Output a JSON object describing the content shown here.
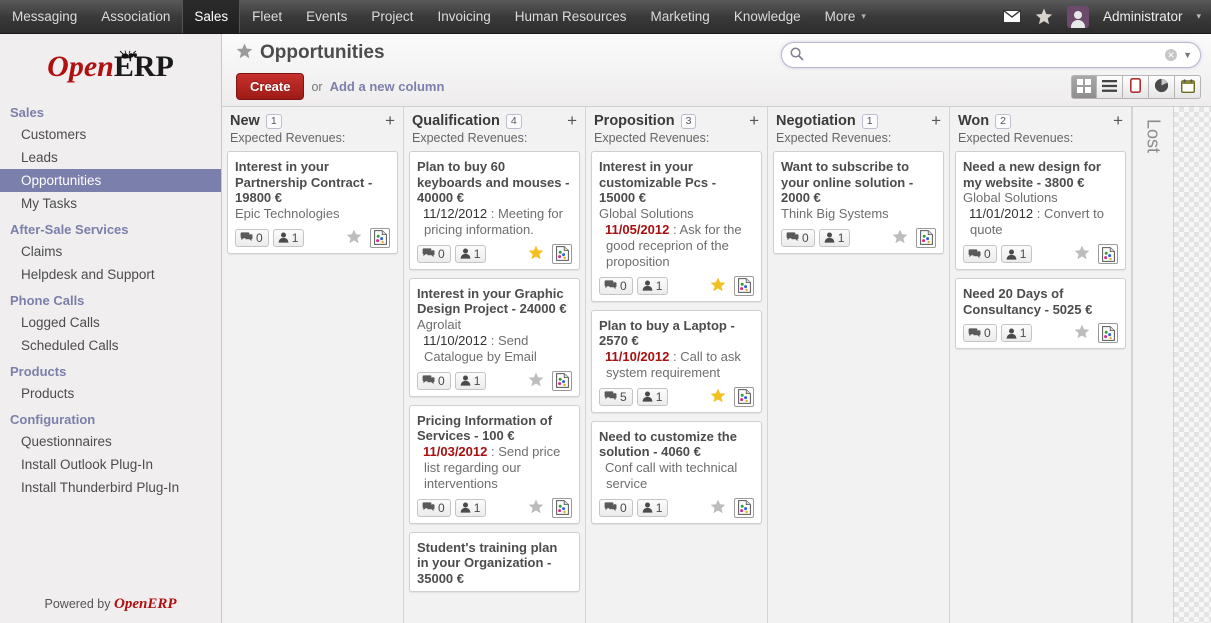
{
  "topbar": {
    "menus": [
      {
        "label": "Messaging",
        "active": false
      },
      {
        "label": "Association",
        "active": false
      },
      {
        "label": "Sales",
        "active": true
      },
      {
        "label": "Fleet",
        "active": false
      },
      {
        "label": "Events",
        "active": false
      },
      {
        "label": "Project",
        "active": false
      },
      {
        "label": "Invoicing",
        "active": false
      },
      {
        "label": "Human Resources",
        "active": false
      },
      {
        "label": "Marketing",
        "active": false
      },
      {
        "label": "Knowledge",
        "active": false
      },
      {
        "label": "More",
        "active": false,
        "caret": true
      }
    ],
    "mail_icon": "envelope-icon",
    "star_icon": "star-icon",
    "username": "Administrator",
    "user_caret": "▾"
  },
  "sidebar": {
    "logo_open": "Open",
    "logo_erp": "ERP",
    "footer_prefix": "Powered by ",
    "footer_brand": "OpenERP",
    "groups": [
      {
        "title": "Sales",
        "items": [
          {
            "label": "Customers",
            "active": false
          },
          {
            "label": "Leads",
            "active": false
          },
          {
            "label": "Opportunities",
            "active": true
          },
          {
            "label": "My Tasks",
            "active": false
          }
        ]
      },
      {
        "title": "After-Sale Services",
        "items": [
          {
            "label": "Claims",
            "active": false
          },
          {
            "label": "Helpdesk and Support",
            "active": false
          }
        ]
      },
      {
        "title": "Phone Calls",
        "items": [
          {
            "label": "Logged Calls",
            "active": false
          },
          {
            "label": "Scheduled Calls",
            "active": false
          }
        ]
      },
      {
        "title": "Products",
        "items": [
          {
            "label": "Products",
            "active": false
          }
        ]
      },
      {
        "title": "Configuration",
        "items": [
          {
            "label": "Questionnaires",
            "active": false
          },
          {
            "label": "Install Outlook Plug-In",
            "active": false
          },
          {
            "label": "Install Thunderbird Plug-In",
            "active": false
          }
        ]
      }
    ]
  },
  "control_panel": {
    "page_title": "Opportunities",
    "title_star_icon": "star-icon",
    "create_label": "Create",
    "or_label": "or",
    "add_column_label": "Add a new column",
    "search": {
      "value": "",
      "placeholder": "",
      "search_icon": "search-icon",
      "clear_icon": "clear-icon",
      "caret_icon": "chevron-down-icon"
    },
    "views": [
      {
        "name": "kanban-view-button",
        "icon": "grid-icon",
        "active": true
      },
      {
        "name": "list-view-button",
        "icon": "list-icon",
        "active": false
      },
      {
        "name": "form-view-button",
        "icon": "form-icon",
        "active": false
      },
      {
        "name": "graph-view-button",
        "icon": "pie-chart-icon",
        "active": false
      },
      {
        "name": "calendar-view-button",
        "icon": "calendar-icon",
        "active": false
      }
    ]
  },
  "kanban": {
    "expected_revenues_label": "Expected Revenues:",
    "add_icon": "plus-icon",
    "lost_column_label": "Lost",
    "columns": [
      {
        "title": "New",
        "count": "1",
        "cards": [
          {
            "title": "Interest in your Partnership Contract",
            "amount": "- 19800 €",
            "partner": "Epic Technologies",
            "date": "",
            "date_overdue": false,
            "note": "",
            "messages": "0",
            "users": "1",
            "starred": false
          }
        ]
      },
      {
        "title": "Qualification",
        "count": "4",
        "cards": [
          {
            "title": "Plan to buy 60 keyboards and mouses",
            "amount": "- 40000 €",
            "partner": "",
            "date": "11/12/2012",
            "date_overdue": false,
            "note": "Meeting for pricing information.",
            "messages": "0",
            "users": "1",
            "starred": true
          },
          {
            "title": "Interest in your Graphic Design Project",
            "amount": "- 24000 €",
            "partner": "Agrolait",
            "date": "11/10/2012",
            "date_overdue": false,
            "note": "Send Catalogue by Email",
            "messages": "0",
            "users": "1",
            "starred": false
          },
          {
            "title": "Pricing Information of Services",
            "amount": "- 100 €",
            "partner": "",
            "date": "11/03/2012",
            "date_overdue": true,
            "note": "Send price list regarding our interventions",
            "messages": "0",
            "users": "1",
            "starred": false
          },
          {
            "title": "Student's training plan in your Organization",
            "amount": "- 35000 €",
            "partner": "",
            "date": "",
            "date_overdue": false,
            "note": "",
            "messages": "",
            "users": "",
            "starred": false
          }
        ]
      },
      {
        "title": "Proposition",
        "count": "3",
        "cards": [
          {
            "title": "Interest in your customizable Pcs",
            "amount": "- 15000 €",
            "partner": "Global Solutions",
            "date": "11/05/2012",
            "date_overdue": true,
            "note": "Ask for the good receprion of the proposition",
            "messages": "0",
            "users": "1",
            "starred": true
          },
          {
            "title": "Plan to buy a Laptop",
            "amount": "- 2570 €",
            "partner": "",
            "date": "11/10/2012",
            "date_overdue": true,
            "note": "Call to ask system requirement",
            "messages": "5",
            "users": "1",
            "starred": true
          },
          {
            "title": "Need to customize the solution",
            "amount": "- 4060 €",
            "partner": "",
            "date": "",
            "date_overdue": false,
            "note": "Conf call with technical service",
            "messages": "0",
            "users": "1",
            "starred": false
          }
        ]
      },
      {
        "title": "Negotiation",
        "count": "1",
        "cards": [
          {
            "title": "Want to subscribe to your online solution",
            "amount": "- 2000 €",
            "partner": "Think Big Systems",
            "date": "",
            "date_overdue": false,
            "note": "",
            "messages": "0",
            "users": "1",
            "starred": false
          }
        ]
      },
      {
        "title": "Won",
        "count": "2",
        "cards": [
          {
            "title": "Need a new design for my website",
            "amount": "- 3800 €",
            "partner": "Global Solutions",
            "date": "11/01/2012",
            "date_overdue": false,
            "note": "Convert to quote",
            "messages": "0",
            "users": "1",
            "starred": false
          },
          {
            "title": "Need 20 Days of Consultancy",
            "amount": "- 5025 €",
            "partner": "",
            "date": "",
            "date_overdue": false,
            "note": "",
            "messages": "0",
            "users": "1",
            "starred": false
          }
        ]
      }
    ]
  },
  "colors": {
    "accent_purple": "#7b7fab",
    "brand_red": "#b01010",
    "create_red": "#9e1b17",
    "overdue_red": "#a81010",
    "star_gold": "#f2c020"
  }
}
